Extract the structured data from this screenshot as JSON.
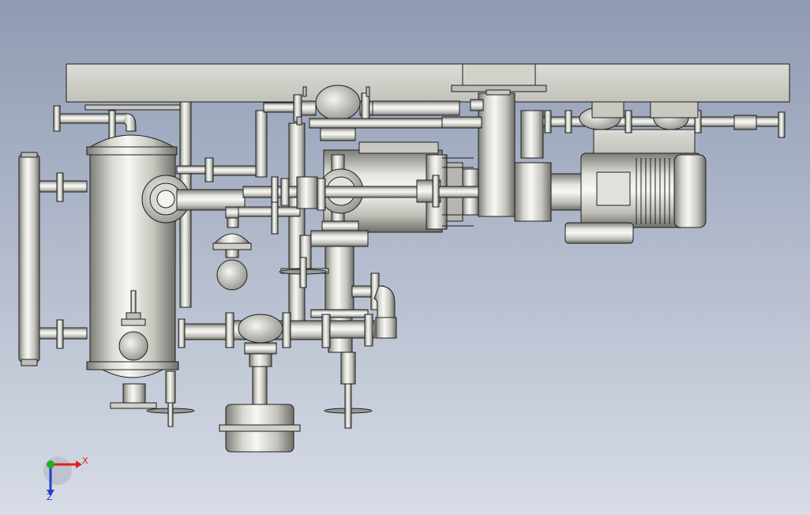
{
  "viewport": {
    "background_top": "#8f9bb3",
    "background_bottom": "#d7dce6"
  },
  "model": {
    "metal_light": "#f2f2ee",
    "metal_mid": "#c9c9c2",
    "metal_dark": "#8a8a84",
    "edge_color": "#1e1e1e"
  },
  "triad": {
    "x_label": "X",
    "z_label": "Z",
    "x_color": "#e02020",
    "y_color": "#20b020",
    "z_color": "#2040d0"
  }
}
